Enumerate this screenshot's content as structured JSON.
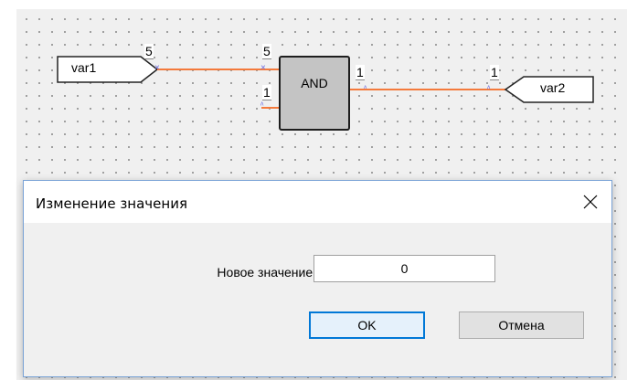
{
  "diagram": {
    "input_var": "var1",
    "input_value": "5",
    "gate_label": "AND",
    "gate_in1_value": "5",
    "gate_in2_value": "1",
    "gate_out_value": "1",
    "output_value": "1",
    "output_var": "var2"
  },
  "dialog": {
    "title": "Изменение значения",
    "field_label": "Новое значение:",
    "field_value": "0",
    "ok_label": "OK",
    "cancel_label": "Отмена",
    "close_icon": "close-icon"
  },
  "colors": {
    "wire": "#f47a3c",
    "gate_fill": "#c4c4c4",
    "ok_border": "#0078d7",
    "canvas_bg": "#f0f0f0"
  }
}
